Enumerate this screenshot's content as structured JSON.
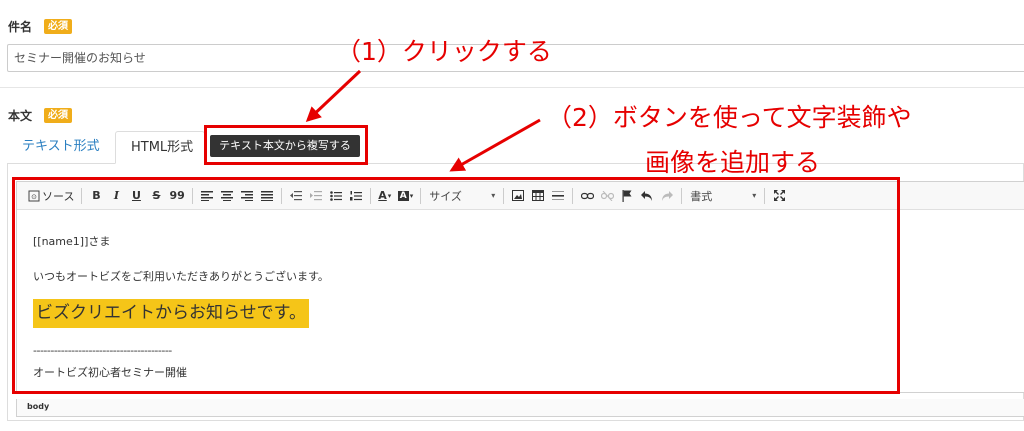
{
  "subject": {
    "label": "件名",
    "required_badge": "必須",
    "value": "セミナー開催のお知らせ"
  },
  "body_field": {
    "label": "本文",
    "required_badge": "必須"
  },
  "tabs": [
    {
      "label": "テキスト形式",
      "active": false
    },
    {
      "label": "HTML形式",
      "active": true
    }
  ],
  "copy_button": {
    "label": "テキスト本文から複写する"
  },
  "toolbar": {
    "source_label": "ソース",
    "bold": "B",
    "italic": "I",
    "underline": "U",
    "strike": "S",
    "quote": "99",
    "text_color": "A",
    "bg_color": "A",
    "size_label": "サイズ",
    "format_label": "書式"
  },
  "editor": {
    "line1": "[[name1]]さま",
    "line2": "いつもオートビズをご利用いただきありがとうございます。",
    "highlight": "ビズクリエイトからお知らせです。",
    "line3": "----------------------------------------",
    "line4": "オートビズ初心者セミナー開催"
  },
  "status_bar": {
    "element_path": "body"
  },
  "annotations": {
    "step1": "（1）クリックする",
    "step2_line1": "（2）ボタンを使って文字装飾や",
    "step2_line2": "画像を追加する"
  },
  "colors": {
    "accent_red": "#e60000",
    "badge_orange": "#f0ad1a",
    "highlight_yellow": "#f5c518",
    "tab_link_blue": "#2a7fc1"
  }
}
